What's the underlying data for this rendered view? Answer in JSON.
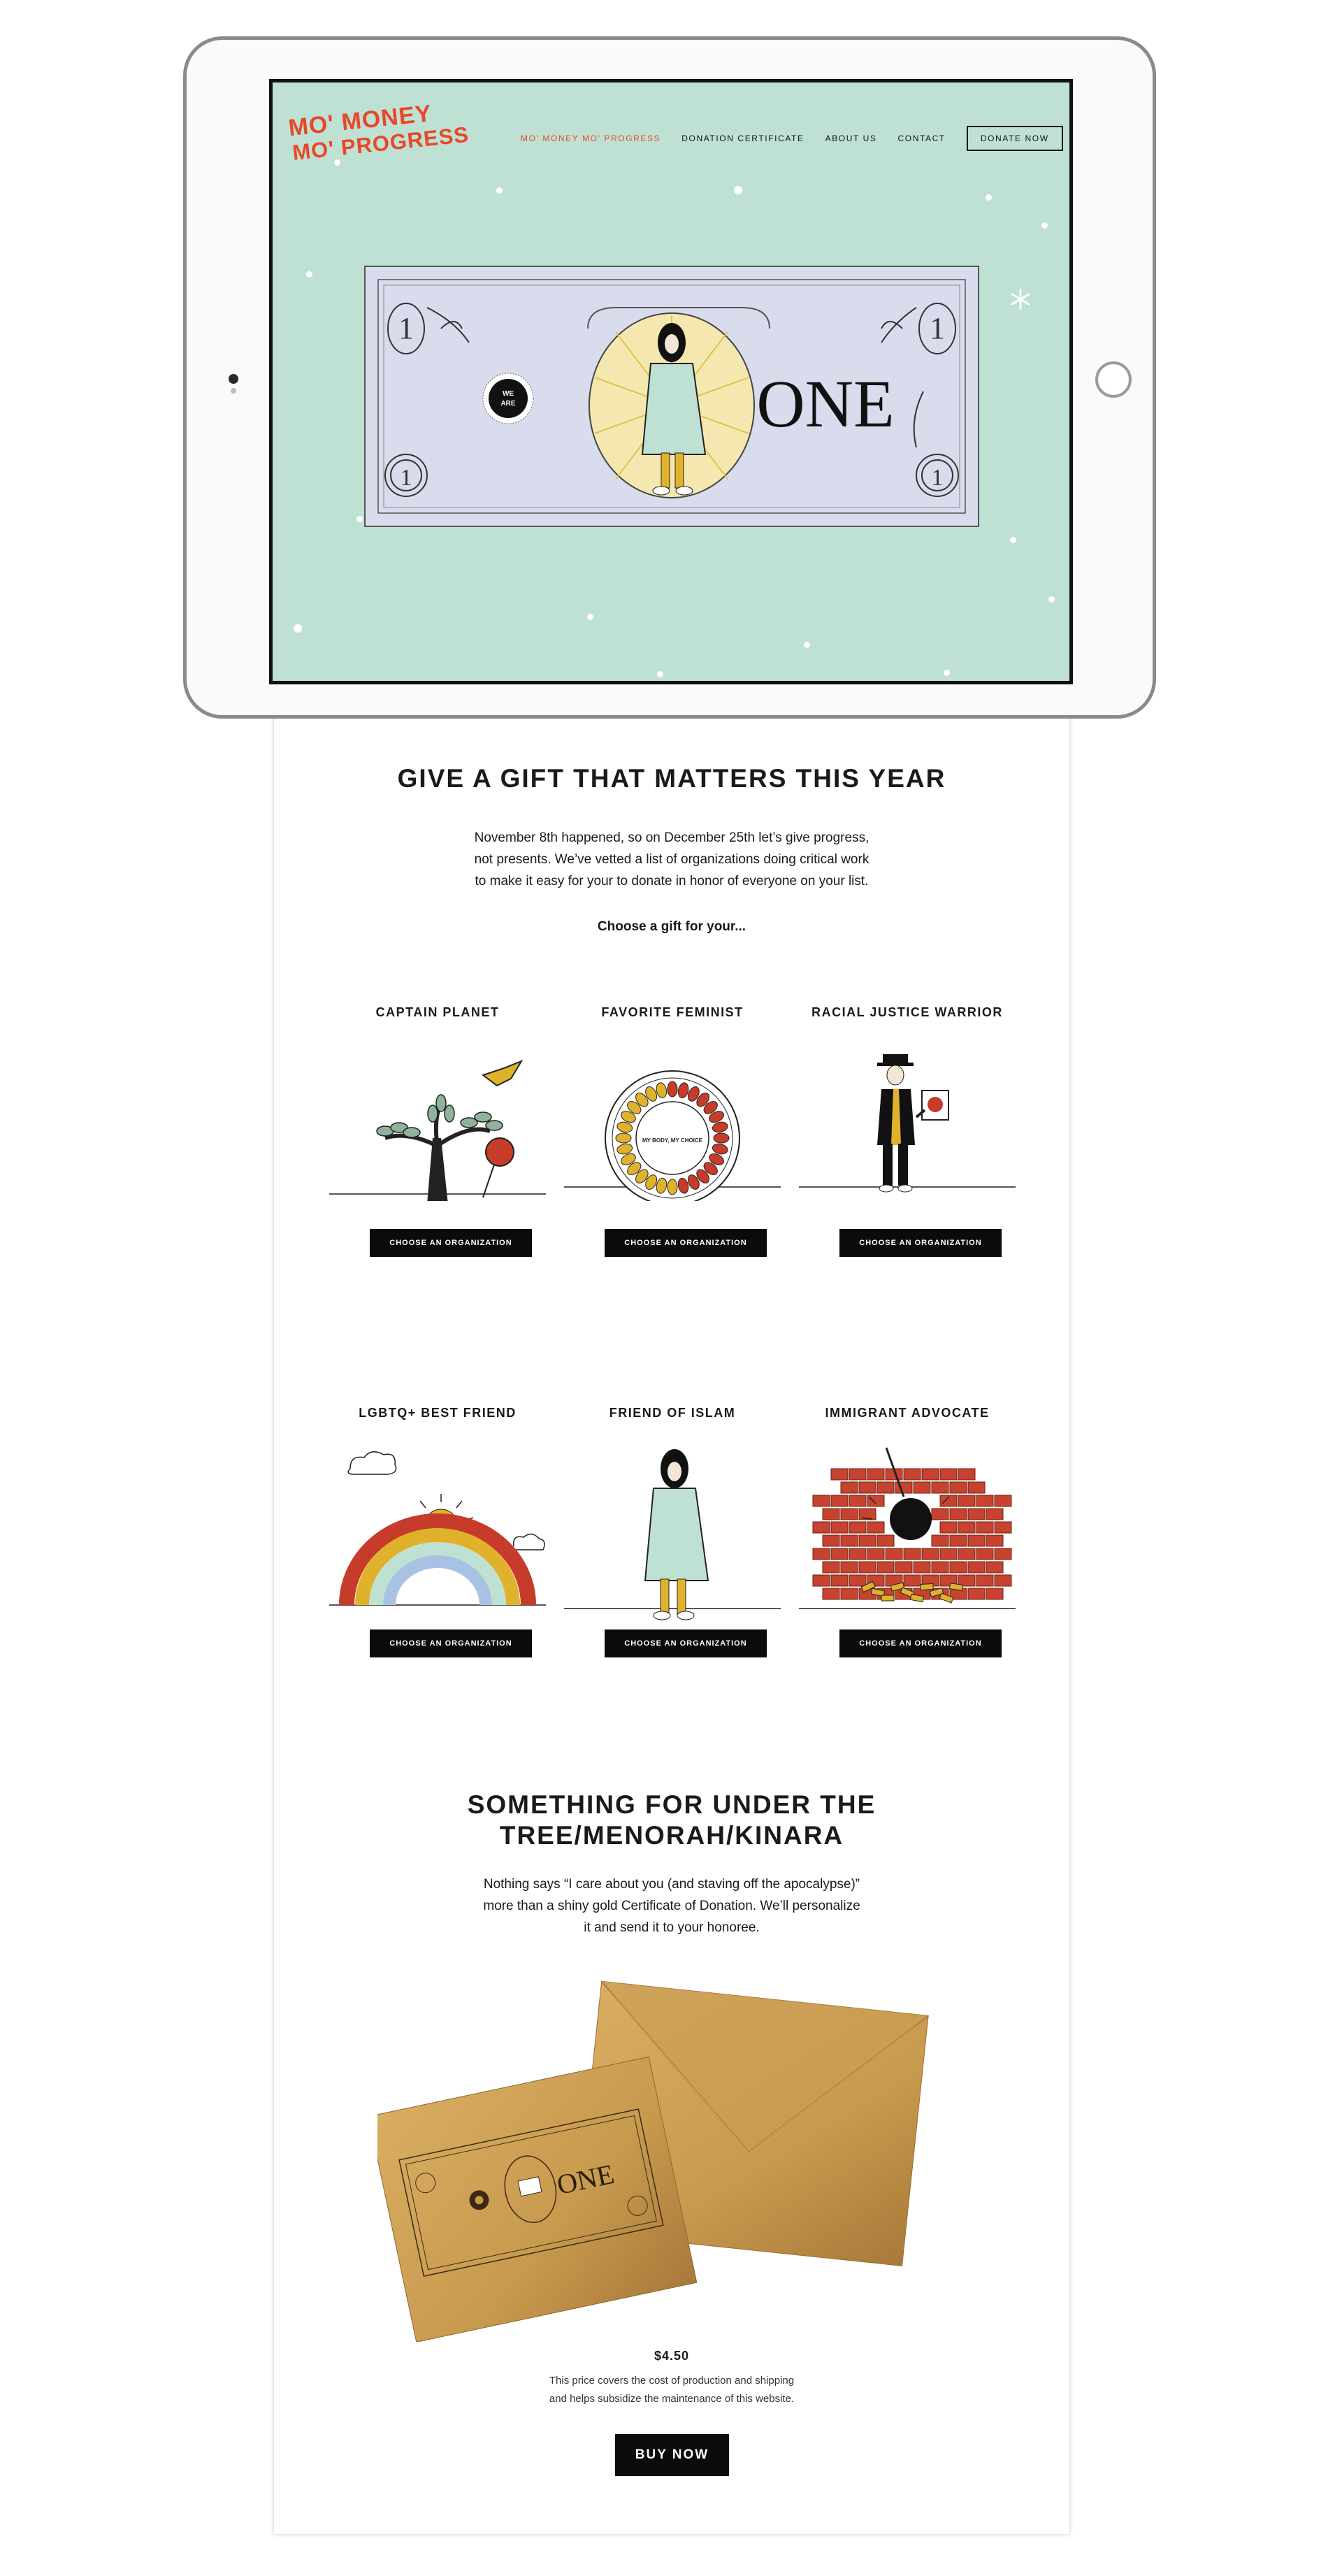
{
  "site": {
    "logo_line1": "MO' MONEY",
    "logo_line2": "MO' PROGRESS",
    "nav": [
      {
        "label": "MO' MONEY MO' PROGRESS",
        "active": true
      },
      {
        "label": "DONATION CERTIFICATE",
        "active": false
      },
      {
        "label": "ABOUT US",
        "active": false
      },
      {
        "label": "CONTACT",
        "active": false
      }
    ],
    "donate_label": "DONATE NOW"
  },
  "hero": {
    "bill_word": "ONE",
    "badge_line1": "WE",
    "badge_line2": "ARE",
    "bill_digit": "1"
  },
  "gift": {
    "heading": "GIVE A GIFT THAT MATTERS THIS YEAR",
    "intro_lines": [
      "November 8th happened, so on December 25th let’s give progress,",
      "not presents. We’ve vetted a list of organizations doing critical work",
      "to make it easy for your to donate in honor of everyone on your list."
    ],
    "choose_prompt": "Choose a gift for your...",
    "button_label": "CHOOSE AN ORGANIZATION",
    "categories": [
      {
        "title": "CAPTAIN PLANET",
        "icon": "tree-bird-rose-icon"
      },
      {
        "title": "FAVORITE FEMINIST",
        "icon": "contraceptive-pill-pack-icon",
        "pill_text": "MY BODY, MY CHOICE"
      },
      {
        "title": "RACIAL JUSTICE WARRIOR",
        "icon": "protester-with-sign-icon"
      },
      {
        "title": "LGBTQ+ BEST FRIEND",
        "icon": "rainbow-sun-clouds-icon"
      },
      {
        "title": "FRIEND OF ISLAM",
        "icon": "woman-in-hijab-icon"
      },
      {
        "title": "IMMIGRANT ADVOCATE",
        "icon": "wrecking-ball-brick-wall-icon"
      }
    ]
  },
  "certificate": {
    "heading_line1": "SOMETHING FOR UNDER THE",
    "heading_line2": "TREE/MENORAH/KINARA",
    "intro_lines": [
      "Nothing says “I care about you (and staving off the apocalypse)”",
      "more than a shiny gold Certificate of Donation. We’ll personalize",
      "it and send it to your honoree."
    ],
    "card_word": "ONE",
    "price": "$4.50",
    "fine_lines": [
      "This price covers the cost of production and shipping",
      "and helps subsidize the maintenance of this website."
    ],
    "buy_label": "BUY NOW"
  },
  "colors": {
    "accent": "#e8482a",
    "mint": "#bfe1d4",
    "bill": "#d8dcec",
    "gold": "#c79a4e",
    "black": "#0b0b0b"
  }
}
